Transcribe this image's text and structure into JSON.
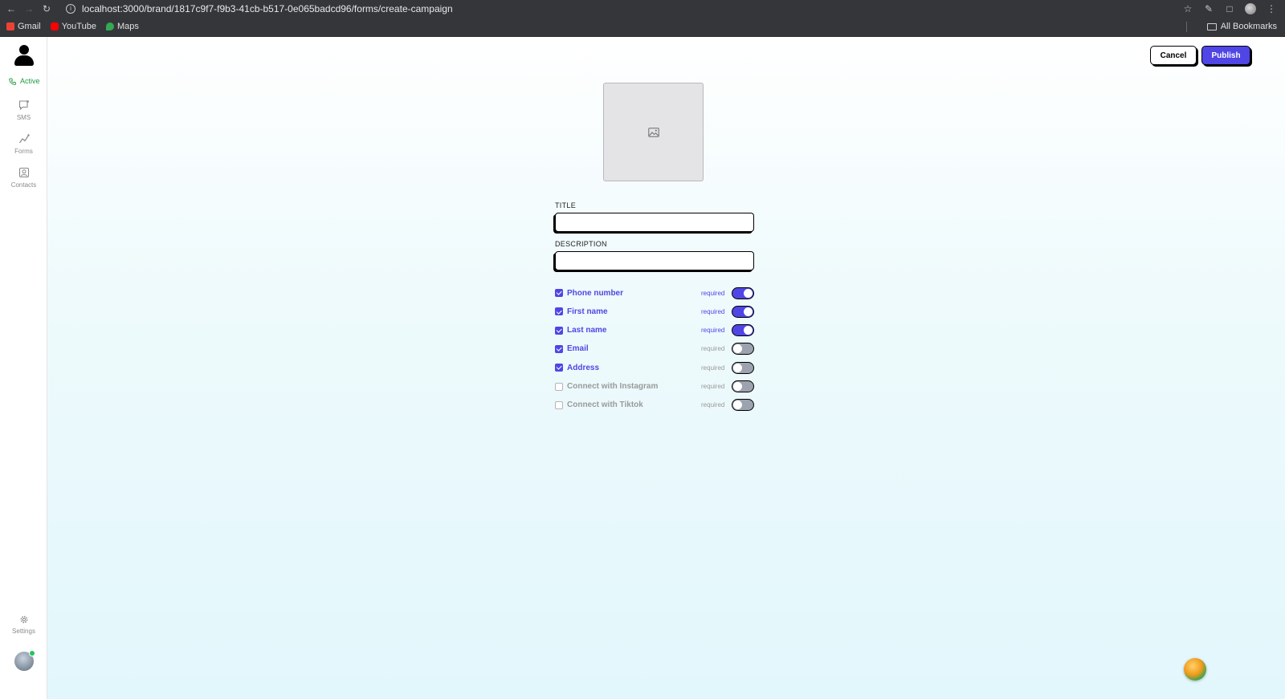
{
  "browser": {
    "url": "localhost:3000/brand/1817c9f7-f9b3-41cb-b517-0e065badcd96/forms/create-campaign",
    "bookmarks": [
      {
        "label": "Gmail",
        "color": "#ea4335"
      },
      {
        "label": "YouTube",
        "color": "#ff0000"
      },
      {
        "label": "Maps",
        "color": "#34a853"
      }
    ],
    "all_bookmarks": "All Bookmarks"
  },
  "sidebar": {
    "status": "Active",
    "items": [
      {
        "label": "SMS",
        "icon": "sms-icon"
      },
      {
        "label": "Forms",
        "icon": "forms-icon"
      },
      {
        "label": "Contacts",
        "icon": "contacts-icon"
      }
    ],
    "settings": "Settings"
  },
  "toolbar": {
    "cancel_label": "Cancel",
    "publish_label": "Publish"
  },
  "form": {
    "title_label": "TITLE",
    "title_value": "",
    "description_label": "DESCRIPTION",
    "description_value": "",
    "required_text": "required",
    "options": [
      {
        "label": "Phone number",
        "checked": true,
        "required": true
      },
      {
        "label": "First name",
        "checked": true,
        "required": true
      },
      {
        "label": "Last name",
        "checked": true,
        "required": true
      },
      {
        "label": "Email",
        "checked": true,
        "required": false
      },
      {
        "label": "Address",
        "checked": true,
        "required": false
      },
      {
        "label": "Connect with Instagram",
        "checked": false,
        "required": false
      },
      {
        "label": "Connect with Tiktok",
        "checked": false,
        "required": false
      }
    ]
  },
  "colors": {
    "accent": "#4f46e5",
    "active_green": "#1f9a3b"
  }
}
